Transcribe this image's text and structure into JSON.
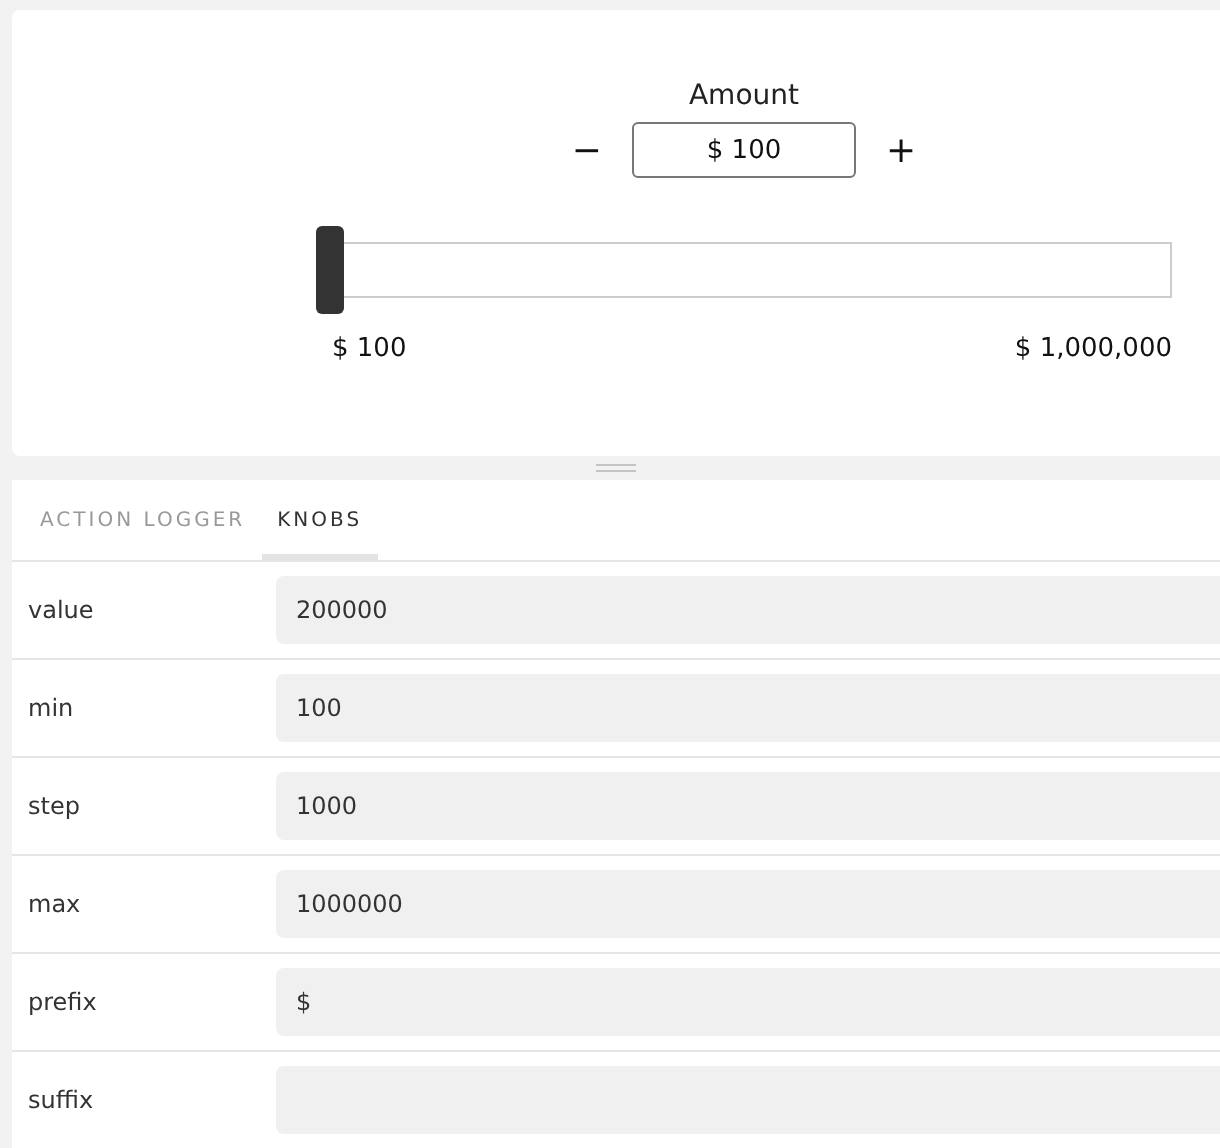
{
  "preview": {
    "label": "Amount",
    "decrement": "−",
    "amount": "$ 100",
    "increment": "+",
    "slider": {
      "level": 0
    },
    "min_label": "$ 100",
    "max_label": "$ 1,000,000"
  },
  "addons": {
    "tabs": [
      {
        "label": "ACTION LOGGER",
        "selected": false
      },
      {
        "label": "KNOBS",
        "selected": true
      }
    ],
    "knobs": [
      {
        "name": "value",
        "value": "200000"
      },
      {
        "name": "min",
        "value": "100"
      },
      {
        "name": "step",
        "value": "1000"
      },
      {
        "name": "max",
        "value": "1000000"
      },
      {
        "name": "prefix",
        "value": "$"
      },
      {
        "name": "suffix"
      }
    ]
  }
}
